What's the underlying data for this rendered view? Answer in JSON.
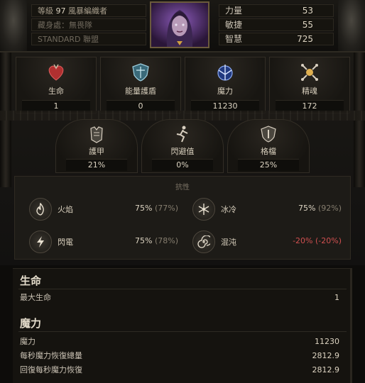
{
  "header": {
    "level_label": "等級",
    "level_value": "97",
    "class_name": "風暴編織者",
    "location": "藏身處：無畏隊",
    "league": "STANDARD",
    "league_suffix": "聯盟"
  },
  "attributes": [
    {
      "name": "力量",
      "value": "53"
    },
    {
      "name": "敏捷",
      "value": "55"
    },
    {
      "name": "智慧",
      "value": "725"
    }
  ],
  "top_stats": [
    {
      "label": "生命",
      "value": "1",
      "icon": "heart-icon"
    },
    {
      "label": "能量護盾",
      "value": "0",
      "icon": "shield-icon"
    },
    {
      "label": "魔力",
      "value": "11230",
      "icon": "mana-icon"
    },
    {
      "label": "精魂",
      "value": "172",
      "icon": "spirit-icon"
    }
  ],
  "defense_stats": [
    {
      "label": "護甲",
      "value": "21%",
      "icon": "armour-icon"
    },
    {
      "label": "閃避值",
      "value": "0%",
      "icon": "evasion-icon"
    },
    {
      "label": "格檔",
      "value": "25%",
      "icon": "block-icon"
    }
  ],
  "resistances": {
    "title": "抗性",
    "items": [
      {
        "name": "火焰",
        "value": "75%",
        "cap": "(77%)",
        "icon": "fire-icon"
      },
      {
        "name": "冰冷",
        "value": "75%",
        "cap": "(92%)",
        "icon": "cold-icon"
      },
      {
        "name": "閃電",
        "value": "75%",
        "cap": "(78%)",
        "icon": "lightning-icon"
      },
      {
        "name": "混沌",
        "value": "-20%",
        "cap": "(-20%)",
        "icon": "chaos-icon"
      }
    ]
  },
  "details": {
    "life_title": "生命",
    "life_rows": [
      {
        "key": "最大生命",
        "value": "1"
      }
    ],
    "mana_title": "魔力",
    "mana_rows": [
      {
        "key": "魔力",
        "value": "11230"
      },
      {
        "key": "每秒魔力恢復總量",
        "value": "2812.9"
      },
      {
        "key": "回復每秒魔力恢復",
        "value": "2812.9"
      }
    ]
  },
  "colors": {
    "negative": "#d05050",
    "frame_gold": "#6b5a3c"
  }
}
